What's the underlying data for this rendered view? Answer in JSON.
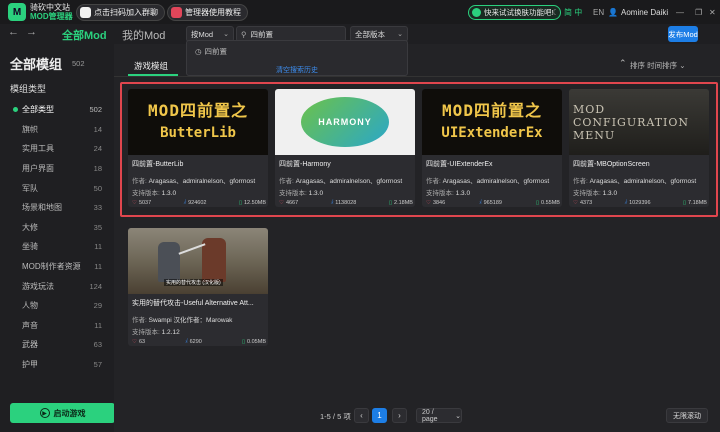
{
  "titlebar": {
    "logo_line1": "骑砍中文站",
    "logo_line2": "MOD管理器",
    "btn_join": "点击扫码加入群聊",
    "btn_tutorial": "管理器使用教程",
    "promo": "快来试试换肤功能吧!",
    "lang_zh": "简 中",
    "lang_en": "EN",
    "user": "Aomine Daiki"
  },
  "nav": {
    "tab_all": "全部Mod",
    "tab_my": "我的Mod",
    "filter_select": "按Mod",
    "search_value": "四前置",
    "version_select": "全部版本",
    "publish": "发布Mod"
  },
  "dropdown": {
    "history_item": "四前置",
    "clear_history": "清空搜索历史"
  },
  "sidebar": {
    "title": "全部模组",
    "count": "502",
    "type_label": "模组类型",
    "launch": "启动游戏",
    "items": [
      {
        "label": "全部类型",
        "count": "502"
      },
      {
        "label": "旗帜",
        "count": "14"
      },
      {
        "label": "实用工具",
        "count": "24"
      },
      {
        "label": "用户界面",
        "count": "18"
      },
      {
        "label": "军队",
        "count": "50"
      },
      {
        "label": "场景和地图",
        "count": "33"
      },
      {
        "label": "大修",
        "count": "35"
      },
      {
        "label": "坐骑",
        "count": "11"
      },
      {
        "label": "MOD制作者资源",
        "count": "11"
      },
      {
        "label": "游戏玩法",
        "count": "124"
      },
      {
        "label": "人物",
        "count": "29"
      },
      {
        "label": "声音",
        "count": "11"
      },
      {
        "label": "武器",
        "count": "63"
      },
      {
        "label": "护甲",
        "count": "57"
      }
    ]
  },
  "content": {
    "subtab": "游戏模组",
    "sort_label": "排序 时间排序"
  },
  "cards": [
    {
      "thumb_line1": "MOD四前置之",
      "thumb_line2": "ButterLib",
      "title": "四前置-ButterLib",
      "author_label": "作者:",
      "author": "Aragasas、admiralnelson、gforrnost",
      "ver_label": "支持版本:",
      "version": "1.3.0",
      "likes": "5037",
      "downloads": "924602",
      "size": "12.50MB"
    },
    {
      "thumb_line1": "HARMONY",
      "thumb_line2": "",
      "title": "四前置-Harmony",
      "author_label": "作者:",
      "author": "Aragasas、admiralnelson、gforrnost",
      "ver_label": "支持版本:",
      "version": "1.3.0",
      "likes": "4667",
      "downloads": "1138028",
      "size": "2.18MB"
    },
    {
      "thumb_line1": "MOD四前置之",
      "thumb_line2": "UIExtenderEx",
      "title": "四前置-UIExtenderEx",
      "author_label": "作者:",
      "author": "Aragasas、admiralnelson、gforrnost",
      "ver_label": "支持版本:",
      "version": "1.3.0",
      "likes": "3846",
      "downloads": "965189",
      "size": "0.55MB"
    },
    {
      "thumb_line1": "MOD",
      "thumb_line2": "CONFIGURATION",
      "thumb_line3": "MENU",
      "title": "四前置-MBOptionScreen",
      "author_label": "作者:",
      "author": "Aragasas、admiralnelson、gforrnost",
      "ver_label": "支持版本:",
      "version": "1.3.0",
      "likes": "4373",
      "downloads": "1029396",
      "size": "7.18MB"
    },
    {
      "thumb_caption": "实用的替代攻击 (汉化版)",
      "title": "实用的替代攻击-Useful Alternative Att...",
      "author_label": "作者:",
      "author": "Swampi 汉化作者：Marowak",
      "ver_label": "支持版本:",
      "version": "1.2.12",
      "likes": "63",
      "downloads": "6290",
      "size": "0.05MB"
    }
  ],
  "pagination": {
    "range": "1-5 / 5 项",
    "current_page": "1",
    "page_size": "20 / page",
    "infinite": "无限滚动"
  },
  "colors": {
    "accent": "#2bd17e",
    "primary": "#1d7ee6",
    "highlight": "#e0464e"
  }
}
